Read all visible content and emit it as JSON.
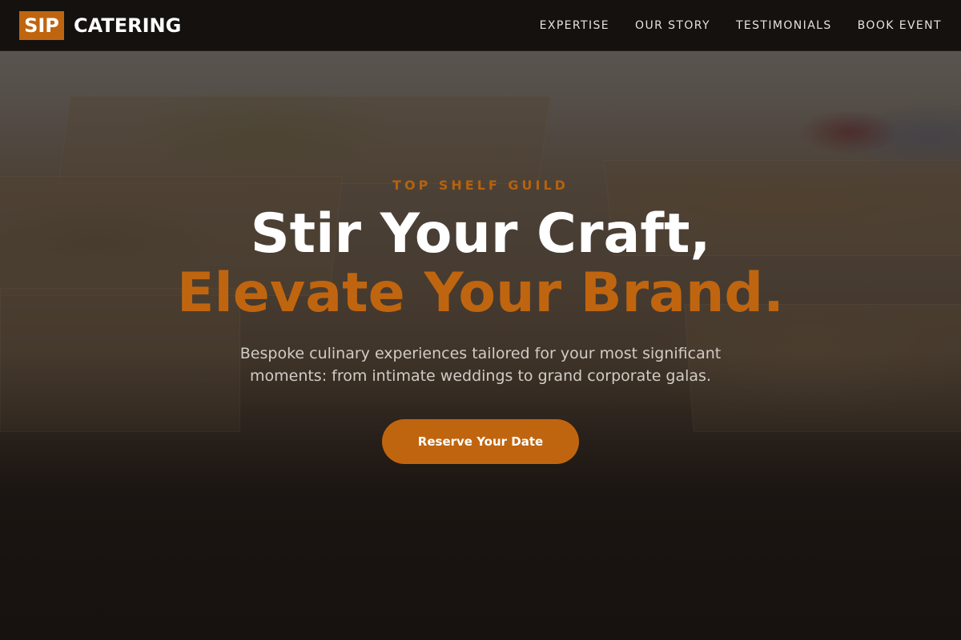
{
  "header": {
    "logo_badge": "SIP",
    "logo_text": "CATERING",
    "nav": [
      {
        "label": "EXPERTISE"
      },
      {
        "label": "OUR STORY"
      },
      {
        "label": "TESTIMONIALS"
      },
      {
        "label": "BOOK EVENT"
      }
    ]
  },
  "hero": {
    "eyebrow": "TOP SHELF GUILD",
    "headline_line1": "Stir Your Craft,",
    "headline_line2": "Elevate Your Brand.",
    "subtitle": "Bespoke culinary experiences tailored for your most significant moments: from intimate weddings to grand corporate galas.",
    "cta_label": "Reserve Your Date"
  },
  "colors": {
    "accent": "#c0650f",
    "header_bg": "#14110f",
    "text_light": "#ffffff"
  }
}
